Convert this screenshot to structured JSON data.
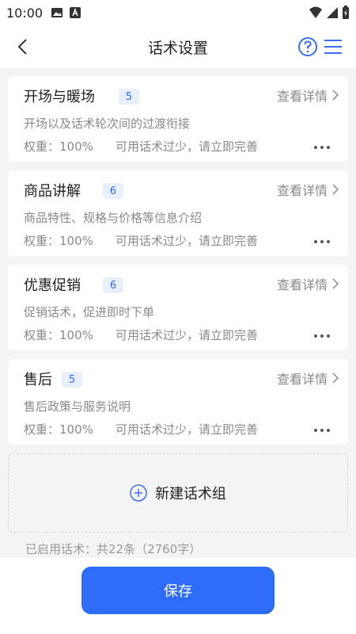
{
  "status_bar": {
    "time": "10:00"
  },
  "header": {
    "title": "话术设置"
  },
  "cards": [
    {
      "title": "开场与暖场",
      "badge": "5",
      "detail": "查看详情",
      "desc": "开场以及话术轮次间的过渡衔接",
      "weight": "权重：100%",
      "warning": "可用话术过少，请立即完善"
    },
    {
      "title": "商品讲解",
      "badge": "6",
      "detail": "查看详情",
      "desc": "商品特性、规格与价格等信息介绍",
      "weight": "权重：100%",
      "warning": "可用话术过少，请立即完善"
    },
    {
      "title": "优惠促销",
      "badge": "6",
      "detail": "查看详情",
      "desc": "促销话术，促进即时下单",
      "weight": "权重：100%",
      "warning": "可用话术过少，请立即完善"
    },
    {
      "title": "售后",
      "badge": "5",
      "detail": "查看详情",
      "desc": "售后政策与服务说明",
      "weight": "权重：100%",
      "warning": "可用话术过少，请立即完善"
    }
  ],
  "add_group": {
    "label": "新建话术组"
  },
  "enabled_summary": "已启用话术：共22条（2760字）",
  "footer": {
    "save_label": "保存"
  },
  "colors": {
    "accent": "#2d6cf6",
    "badge_bg": "#e8efff",
    "badge_text": "#3366ff"
  }
}
